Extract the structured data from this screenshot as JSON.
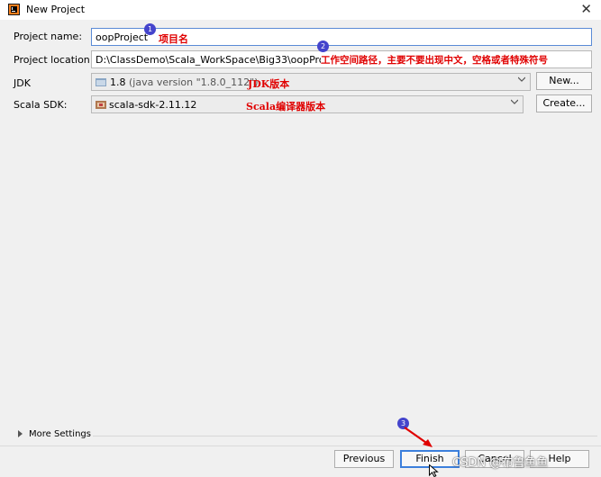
{
  "window": {
    "title": "New Project",
    "close_glyph": "✕"
  },
  "form": {
    "project_name": {
      "label": "Project name:",
      "value": "oopProject"
    },
    "project_location": {
      "label": "Project location:",
      "value": "D:\\ClassDemo\\Scala_WorkSpace\\Big33\\oopProject"
    },
    "jdk": {
      "label": "JDK",
      "version": "1.8",
      "detail": "(java version \"1.8.0_112\")",
      "button": "New..."
    },
    "scala_sdk": {
      "label": "Scala SDK:",
      "value": "scala-sdk-2.11.12",
      "button": "Create..."
    }
  },
  "annotations": {
    "project_name": "项目名",
    "project_location": "工作空间路径，主要不要出现中文，空格或者特殊符号",
    "jdk": "JDK版本",
    "scala_sdk": "Scala编译器版本",
    "step_badges": [
      "1",
      "2",
      "3"
    ]
  },
  "more_settings": {
    "label": "More Settings"
  },
  "footer": {
    "previous": "Previous",
    "finish": "Finish",
    "cancel": "Cancel",
    "help": "Help"
  },
  "watermark": "CSDN @布鲁鱼鱼",
  "colors": {
    "annotation": "#e00000",
    "badge": "#4444cc",
    "focus_border": "#5a8bd6"
  }
}
